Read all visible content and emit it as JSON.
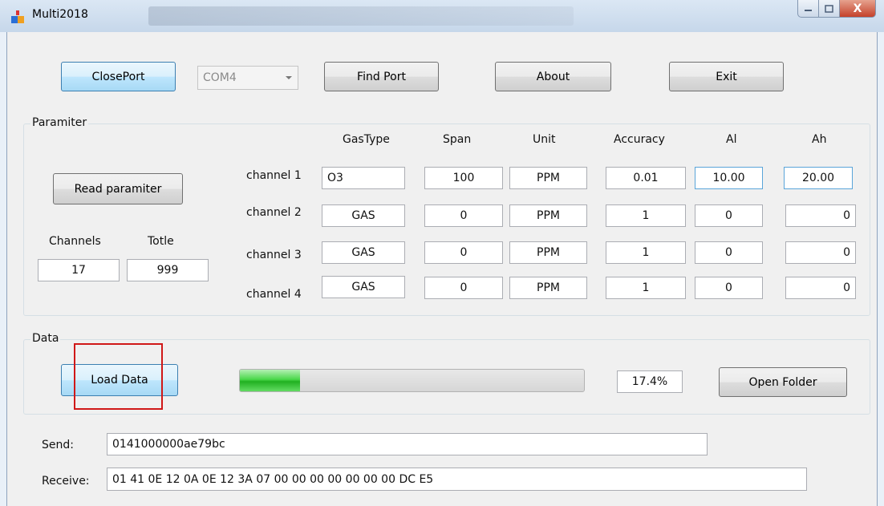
{
  "window": {
    "title": "Multi2018",
    "close_glyph": "X"
  },
  "toolbar": {
    "close_port": "ClosePort",
    "com_port": "COM4",
    "find_port": "Find Port",
    "about": "About",
    "exit": "Exit"
  },
  "parameter": {
    "group_title": "Paramiter",
    "read_button": "Read paramiter",
    "channels_label": "Channels",
    "totle_label": "Totle",
    "channels_value": "17",
    "totle_value": "999",
    "headers": [
      "GasType",
      "Span",
      "Unit",
      "Accuracy",
      "Al",
      "Ah"
    ],
    "rows": [
      {
        "label": "channel 1",
        "gas": "O3",
        "span": "100",
        "unit": "PPM",
        "accuracy": "0.01",
        "al": "10.00",
        "ah": "20.00"
      },
      {
        "label": "channel 2",
        "gas": "GAS",
        "span": "0",
        "unit": "PPM",
        "accuracy": "1",
        "al": "0",
        "ah": "0"
      },
      {
        "label": "channel 3",
        "gas": "GAS",
        "span": "0",
        "unit": "PPM",
        "accuracy": "1",
        "al": "0",
        "ah": "0"
      },
      {
        "label": "channel 4",
        "gas": "GAS",
        "span": "0",
        "unit": "PPM",
        "accuracy": "1",
        "al": "0",
        "ah": "0"
      }
    ]
  },
  "data_group": {
    "group_title": "Data",
    "load_button": "Load Data",
    "progress_fraction": 0.174,
    "progress_text": "17.4%",
    "open_folder": "Open Folder"
  },
  "comm": {
    "send_label": "Send:",
    "send_value": "0141000000ae79bc",
    "receive_label": "Receive:",
    "receive_value": "01 41 0E 12 0A 0E 12 3A 07 00 00 00 00 00 00 00 DC E5"
  },
  "colors": {
    "highlight_box": "#d01818",
    "progress_fill": "#2fc12f",
    "focus_button": "#3c7fb1"
  }
}
